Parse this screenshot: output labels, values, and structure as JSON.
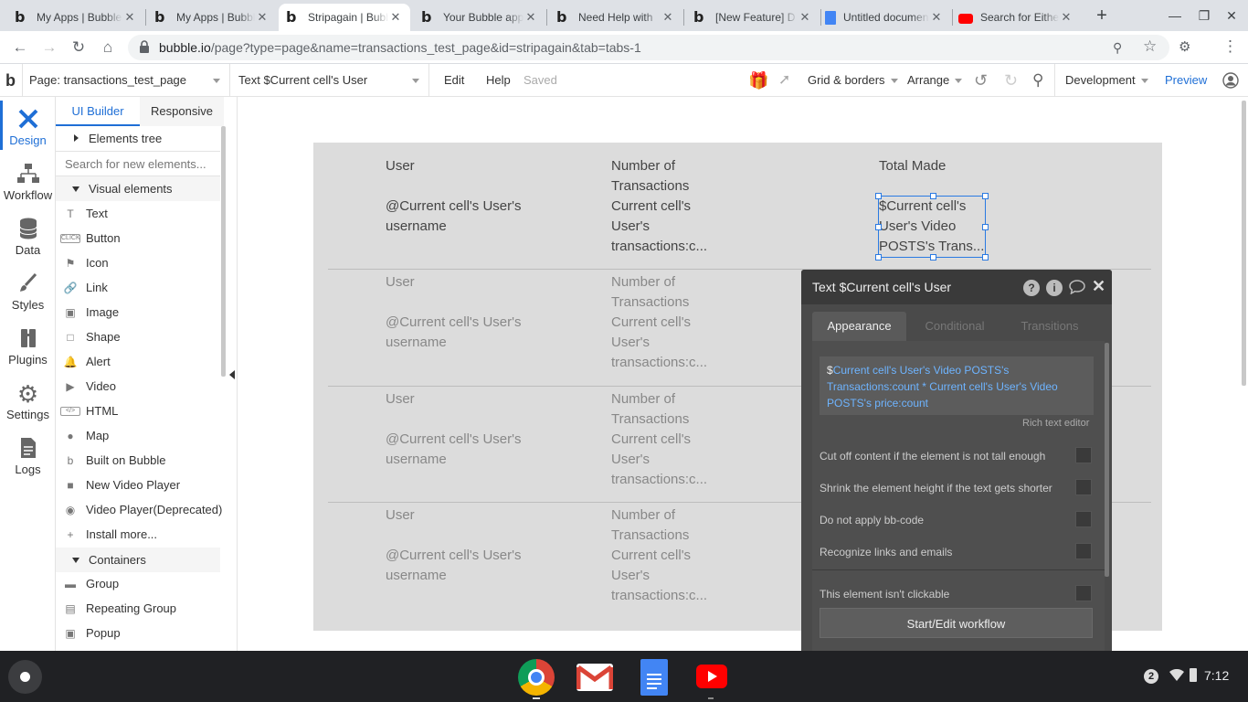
{
  "browser": {
    "tabs": [
      {
        "title": "My Apps | Bubble",
        "favicon": "bubble-b-icon",
        "active": false
      },
      {
        "title": "My Apps | Bubble",
        "favicon": "bubble-b-icon",
        "active": false
      },
      {
        "title": "Stripagain | Bubble",
        "favicon": "bubble-b-icon",
        "active": true
      },
      {
        "title": "Your Bubble app",
        "favicon": "bubble-b-icon",
        "active": false
      },
      {
        "title": "Need Help with",
        "favicon": "bubble-b-icon",
        "active": false
      },
      {
        "title": "[New Feature] D",
        "favicon": "bubble-b-icon",
        "active": false
      },
      {
        "title": "Untitled document",
        "favicon": "docs-icon",
        "active": false
      },
      {
        "title": "Search for Either",
        "favicon": "youtube-icon",
        "active": false
      }
    ],
    "url_host": "bubble.io",
    "url_path": "/page?type=page&name=transactions_test_page&id=stripagain&tab=tabs-1"
  },
  "editor_bar": {
    "page_selector": "Page: transactions_test_page",
    "element_selector": "Text $Current cell's User",
    "edit": "Edit",
    "help": "Help",
    "status": "Saved",
    "grid": "Grid & borders",
    "arrange": "Arrange",
    "mode": "Development",
    "preview": "Preview"
  },
  "left_nav": [
    {
      "label": "Design",
      "icon": "design-icon",
      "active": true
    },
    {
      "label": "Workflow",
      "icon": "workflow-icon",
      "active": false
    },
    {
      "label": "Data",
      "icon": "database-icon",
      "active": false
    },
    {
      "label": "Styles",
      "icon": "brush-icon",
      "active": false
    },
    {
      "label": "Plugins",
      "icon": "plug-icon",
      "active": false
    },
    {
      "label": "Settings",
      "icon": "gear-icon",
      "active": false
    },
    {
      "label": "Logs",
      "icon": "log-document-icon",
      "active": false
    }
  ],
  "palette": {
    "tab_builder": "UI Builder",
    "tab_responsive": "Responsive",
    "elements_tree": "Elements tree",
    "search_placeholder": "Search for new elements...",
    "visual_header": "Visual elements",
    "visual": [
      {
        "label": "Text",
        "icon": "T"
      },
      {
        "label": "Button",
        "icon": "CLICK"
      },
      {
        "label": "Icon",
        "icon": "⚑"
      },
      {
        "label": "Link",
        "icon": "🔗"
      },
      {
        "label": "Image",
        "icon": "▣"
      },
      {
        "label": "Shape",
        "icon": "□"
      },
      {
        "label": "Alert",
        "icon": "🔔"
      },
      {
        "label": "Video",
        "icon": "▶"
      },
      {
        "label": "HTML",
        "icon": "</>"
      },
      {
        "label": "Map",
        "icon": "●"
      },
      {
        "label": "Built on Bubble",
        "icon": "b"
      },
      {
        "label": "New Video Player",
        "icon": "■"
      },
      {
        "label": "Video Player(Deprecated)",
        "icon": "◉"
      },
      {
        "label": "Install more...",
        "icon": "+"
      }
    ],
    "containers_header": "Containers",
    "containers": [
      {
        "label": "Group",
        "icon": "▬"
      },
      {
        "label": "Repeating Group",
        "icon": "▤"
      },
      {
        "label": "Popup",
        "icon": "▣"
      }
    ]
  },
  "repeating_group": {
    "header": {
      "user": "User",
      "transactions": "Number of Transactions",
      "total": "Total Made"
    },
    "cell": {
      "user": "User",
      "username": "@Current cell's User's username",
      "transactions_label": "Number of Transactions",
      "transactions_value": "Current cell's User's transactions:c...",
      "selected_total": "$Current cell's User's Video POSTS's Trans..."
    }
  },
  "property_editor": {
    "title": "Text $Current cell's User",
    "tabs": [
      "Appearance",
      "Conditional",
      "Transitions"
    ],
    "expr_prefix": "$",
    "expression": "Current cell's User's Video POSTS's Transactions:count * Current cell's User's Video POSTS's price:count",
    "rich_text": "Rich text editor",
    "options": [
      "Cut off content if the element is not tall enough",
      "Shrink the element height if the text gets shorter",
      "Do not apply bb-code",
      "Recognize links and emails",
      "This element isn't clickable"
    ],
    "workflow_button": "Start/Edit workflow"
  },
  "shelf": {
    "notifications": "2",
    "time": "7:12"
  }
}
